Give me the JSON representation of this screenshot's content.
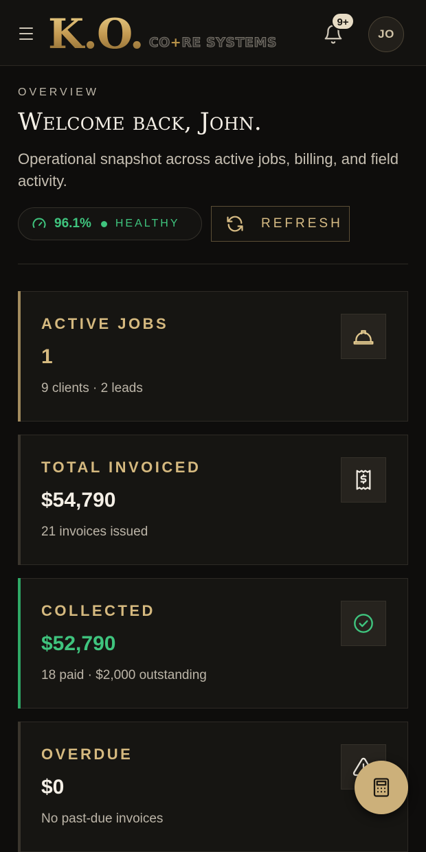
{
  "header": {
    "logo_mark": "K.O.",
    "logo_sub_pre": "CO",
    "logo_sub_plus": "+",
    "logo_sub_post": "RE SYSTEMS",
    "notification_badge": "9+",
    "avatar_initials": "JO"
  },
  "overview": {
    "eyebrow": "OVERVIEW",
    "welcome": "Welcome back, John.",
    "subtitle": "Operational snapshot across active jobs, billing, and field activity.",
    "health_percent": "96.1%",
    "health_status": "HEALTHY",
    "refresh_label": "REFRESH"
  },
  "cards": [
    {
      "title": "ACTIVE JOBS",
      "value": "1",
      "meta": "9 clients · 2 leads",
      "icon": "hard-hat-icon"
    },
    {
      "title": "TOTAL INVOICED",
      "value": "$54,790",
      "meta": "21 invoices issued",
      "icon": "receipt-dollar-icon"
    },
    {
      "title": "COLLECTED",
      "value": "$52,790",
      "meta": "18 paid · $2,000 outstanding",
      "icon": "check-circle-icon"
    },
    {
      "title": "OVERDUE",
      "value": "$0",
      "meta": "No past-due invoices",
      "icon": "alert-triangle-icon"
    }
  ],
  "colors": {
    "gold": "#d5b97f",
    "green": "#3fc47e",
    "background": "#0e0d0c",
    "card": "#161512",
    "fab": "#ccb07a"
  },
  "fab": {
    "icon": "calculator-icon"
  }
}
